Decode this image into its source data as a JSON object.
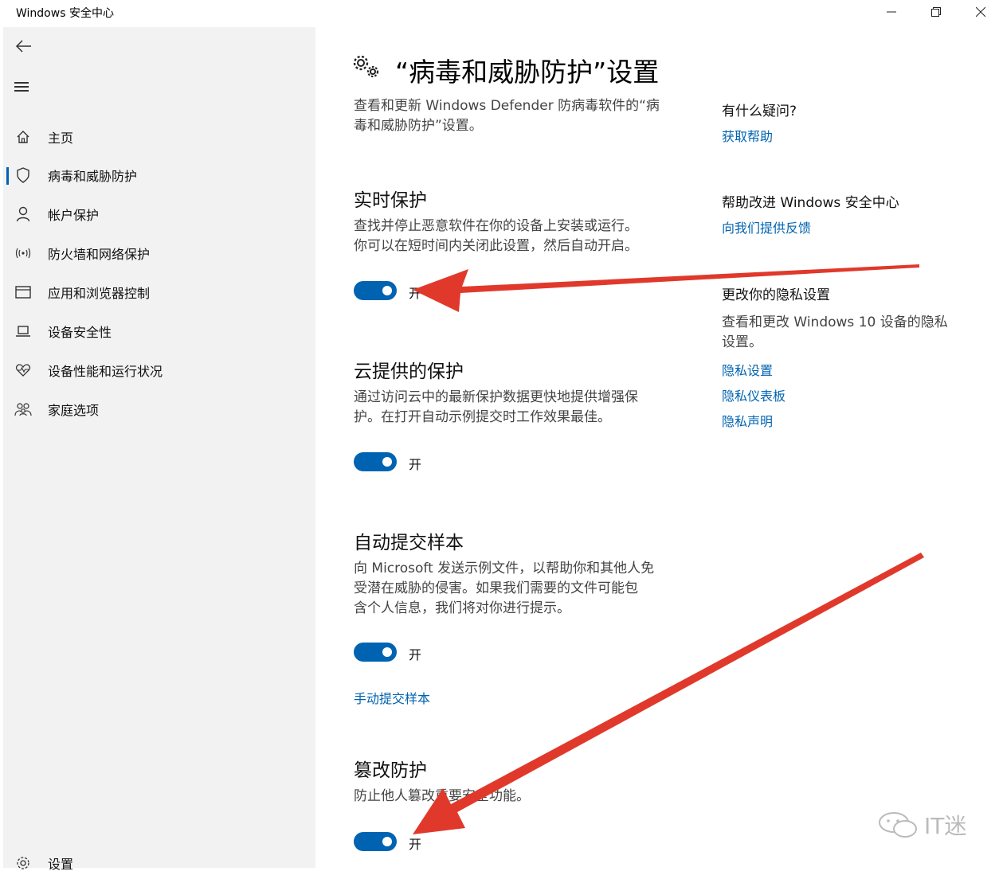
{
  "window": {
    "title": "Windows 安全中心",
    "controls": [
      "minimize-icon",
      "restore-icon",
      "close-icon"
    ]
  },
  "sidebar": {
    "back_icon": "back-arrow-icon",
    "menu_icon": "hamburger-menu-icon",
    "items": [
      {
        "label": "主页",
        "icon": "home-icon",
        "active": false
      },
      {
        "label": "病毒和威胁防护",
        "icon": "shield-icon",
        "active": true
      },
      {
        "label": "帐户保护",
        "icon": "person-icon",
        "active": false
      },
      {
        "label": "防火墙和网络保护",
        "icon": "wireless-icon",
        "active": false
      },
      {
        "label": "应用和浏览器控制",
        "icon": "browser-window-icon",
        "active": false
      },
      {
        "label": "设备安全性",
        "icon": "laptop-icon",
        "active": false
      },
      {
        "label": "设备性能和运行状况",
        "icon": "heart-pulse-icon",
        "active": false
      },
      {
        "label": "家庭选项",
        "icon": "family-icon",
        "active": false
      }
    ],
    "settings": {
      "label": "设置",
      "icon": "gear-icon"
    }
  },
  "main": {
    "title": "“病毒和威胁防护”设置",
    "intro_line1": "查看和更新 Windows Defender 防病毒软件的“病",
    "intro_line2": "毒和威胁防护”设置。",
    "sections": [
      {
        "title": "实时保护",
        "desc_line1": "查找并停止恶意软件在你的设备上安装或运行。",
        "desc_line2": "你可以在短时间内关闭此设置，然后自动开启。",
        "toggle_label": "开",
        "toggle_on": true
      },
      {
        "title": "云提供的保护",
        "desc_line1": "通过访问云中的最新保护数据更快地提供增强保",
        "desc_line2": "护。在打开自动示例提交时工作效果最佳。",
        "toggle_label": "开",
        "toggle_on": true
      },
      {
        "title": "自动提交样本",
        "desc_line1": "向 Microsoft 发送示例文件，以帮助你和其他人免",
        "desc_line2": "受潜在威胁的侵害。如果我们需要的文件可能包",
        "desc_line3": "含个人信息，我们将对你进行提示。",
        "toggle_label": "开",
        "toggle_on": true,
        "link": "手动提交样本"
      },
      {
        "title": "篡改防护",
        "desc_line1": "防止他人篡改重要安全功能。",
        "toggle_label": "开",
        "toggle_on": true
      }
    ]
  },
  "aside": {
    "question_head": "有什么疑问?",
    "help_link": "获取帮助",
    "improve_head": "帮助改进 Windows 安全中心",
    "feedback_link": "向我们提供反馈",
    "privacy_head": "更改你的隐私设置",
    "privacy_text_line1": "查看和更改 Windows 10 设备的隐私",
    "privacy_text_line2": "设置。",
    "privacy_links": [
      "隐私设置",
      "隐私仪表板",
      "隐私声明"
    ]
  },
  "watermark": {
    "text": "IT迷",
    "icon": "wechat-icon"
  },
  "colors": {
    "accent": "#0063b1",
    "arrow": "#e0392b",
    "sidebar_bg": "#f2f2f2"
  }
}
